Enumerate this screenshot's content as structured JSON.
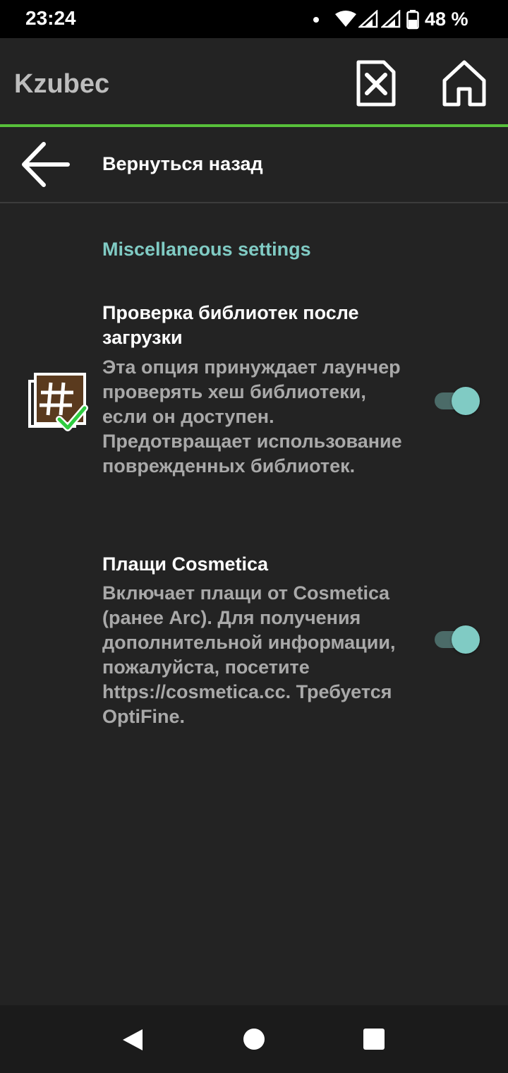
{
  "status_bar": {
    "time": "23:24",
    "battery_text": "48 %",
    "icons": [
      "notification-dot",
      "wifi-icon",
      "signal-icon",
      "signal-icon",
      "battery-icon"
    ]
  },
  "toolbar": {
    "title": "Kzubec",
    "delete_icon": "delete-file-icon",
    "home_icon": "home-icon",
    "accent_color": "#57c03a"
  },
  "back": {
    "label": "Вернуться назад",
    "icon": "arrow-left-icon"
  },
  "section": {
    "title": "Miscellaneous settings",
    "title_color": "#80cbc4"
  },
  "settings": [
    {
      "title": "Проверка библиотек после загрузки",
      "summary": "Эта опция принуждает лаунчер проверять хеш библиотеки, если он доступен. Предотвращает использование поврежденных библиотек.",
      "icon": "hash-check-icon",
      "enabled": true
    },
    {
      "title": "Плащи Cosmetica",
      "summary": "Включает плащи от Cosmetica (ранее Arc). Для получения дополнительной информации, пожалуйста, посетите https://cosmetica.cc. Требуется OptiFine.",
      "enabled": true
    }
  ],
  "nav_bar": {
    "back_icon": "nav-back-icon",
    "home_icon": "nav-home-icon",
    "recents_icon": "nav-recents-icon"
  }
}
